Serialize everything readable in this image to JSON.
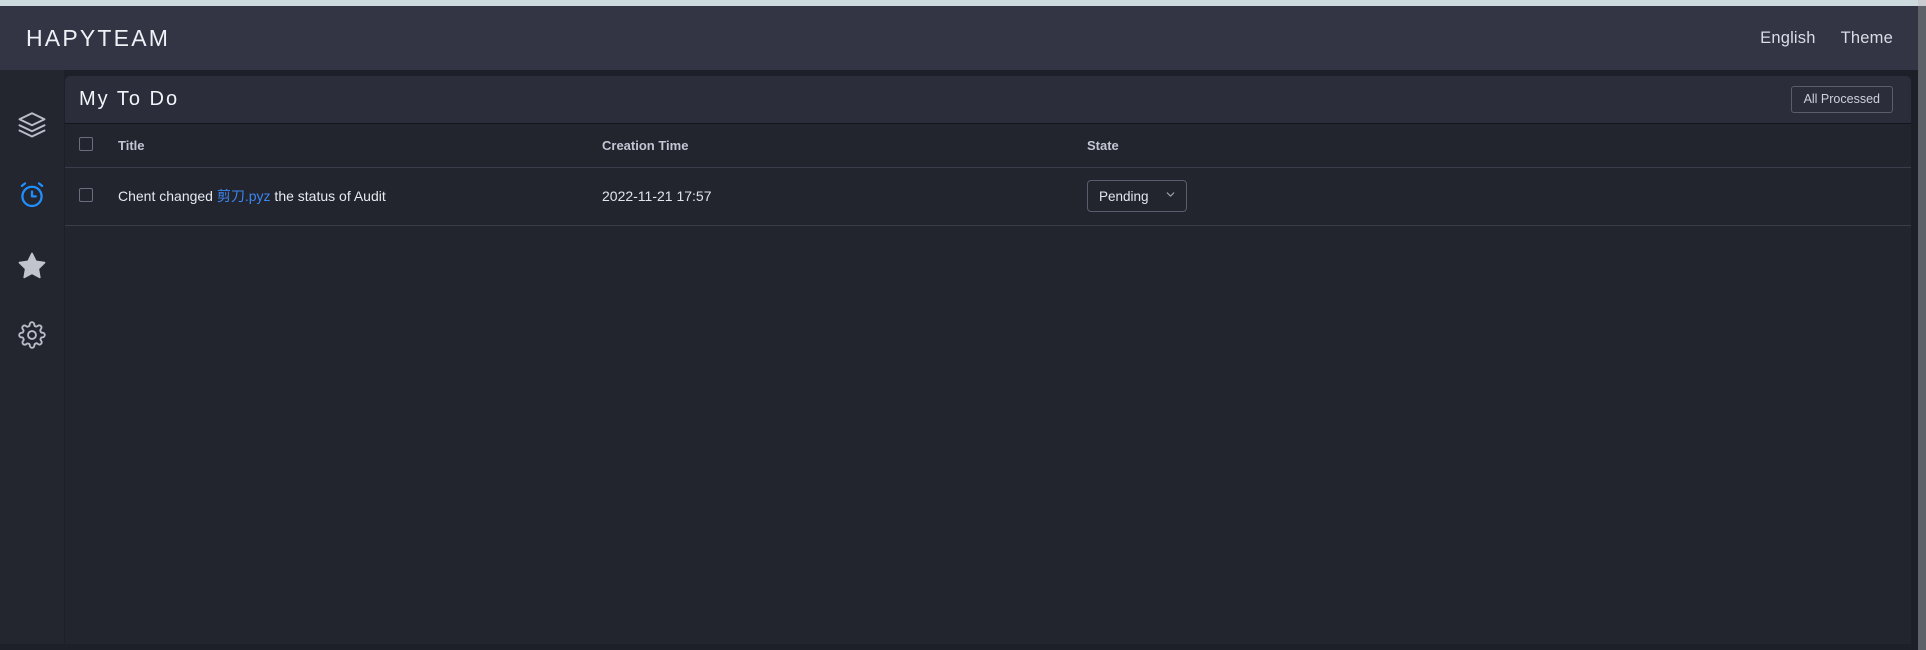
{
  "topbar": {
    "brand": "HAPYTEAM",
    "links": [
      {
        "label": "English",
        "name": "language-link"
      },
      {
        "label": "Theme",
        "name": "theme-link"
      }
    ]
  },
  "sidebar": {
    "items": [
      {
        "icon": "layers-icon",
        "active": false,
        "color": "#b9bdc7"
      },
      {
        "icon": "alarm-clock-icon",
        "active": true,
        "color": "#1f8fff"
      },
      {
        "icon": "star-icon",
        "active": false,
        "color": "#c1c4cc"
      },
      {
        "icon": "gear-icon",
        "active": false,
        "color": "#b9bdc7"
      }
    ]
  },
  "card": {
    "title": "My To Do",
    "action_button": "All Processed"
  },
  "table": {
    "columns": [
      "Title",
      "Creation Time",
      "State"
    ],
    "rows": [
      {
        "title_prefix": "Chent changed ",
        "title_link": "剪刀.pyz",
        "title_suffix": " the status of Audit",
        "creation_time": "2022-11-21 17:57",
        "state": "Pending"
      }
    ]
  },
  "colors": {
    "topbar_bg": "#333544",
    "sidebar_bg": "#23252f",
    "page_bg": "#1d1f29",
    "card_bg": "#22242e",
    "card_header_bg": "#2b2d3a",
    "link_blue": "#3b86f0",
    "active_icon": "#1f8fff",
    "border": "#3a3d4a"
  }
}
